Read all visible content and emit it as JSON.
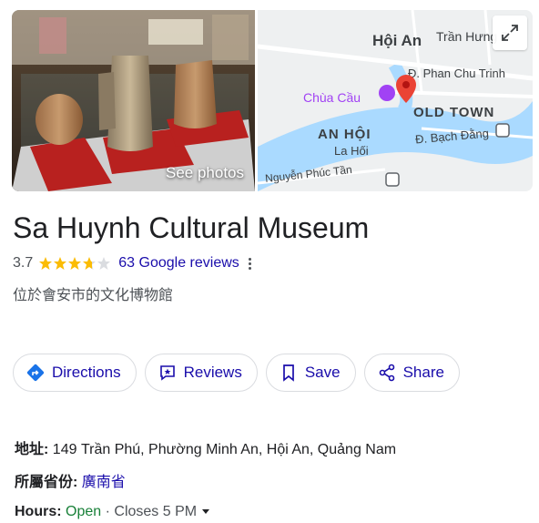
{
  "media": {
    "see_photos_label": "See photos"
  },
  "map": {
    "labels": {
      "hoi_an": "Hội An",
      "tran_hung": "Trần Hưng Đ",
      "phan_chu_trinh": "Đ. Phan Chu Trinh",
      "chua_cau": "Chùa Cầu",
      "old_town": "OLD TOWN",
      "an_hoi": "AN HỘI",
      "bach_dang": "Đ. Bạch Đằng",
      "la_hoi": "La Hối",
      "nguyen_phuc_tan": "Nguyễn Phúc Tần"
    },
    "colors": {
      "water": "#aadaff",
      "pin": "#ea4335",
      "poi": "#a142f4"
    }
  },
  "place": {
    "title": "Sa Huynh Cultural Museum",
    "rating": "3.7",
    "rating_value": 3.7,
    "reviews_link": "63 Google reviews",
    "subtitle": "位於會安市的文化博物館"
  },
  "actions": {
    "directions": "Directions",
    "reviews": "Reviews",
    "save": "Save",
    "share": "Share"
  },
  "info": {
    "address_label": "地址:",
    "address_value": "149 Trần Phú, Phường Minh An, Hội An, Quảng Nam",
    "province_label": "所屬省份:",
    "province_value": "廣南省",
    "hours_label": "Hours:",
    "hours_status": "Open",
    "hours_separator": "·",
    "hours_close": "Closes 5 PM"
  },
  "colors": {
    "link": "#1a0dab",
    "star": "#fbbc04",
    "open": "#188038"
  }
}
